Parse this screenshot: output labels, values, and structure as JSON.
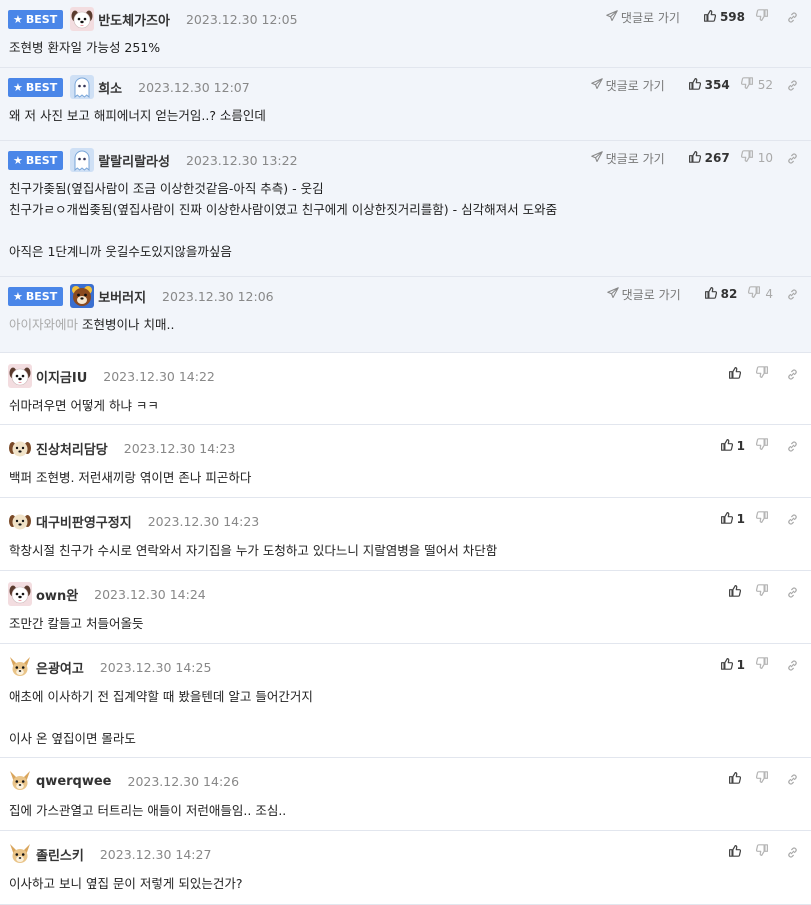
{
  "best_badge_label": "BEST",
  "goto_label": "댓글로 가기",
  "colors": {
    "accent": "#4a86e8",
    "best_bg": "#f2f5fa"
  },
  "comments": [
    {
      "best": true,
      "nick": "반도체가즈아",
      "date": "2023.12.30 12:05",
      "lines": [
        "조현병 환자일 가능성 251%"
      ],
      "muted_prefix": "",
      "up": "598",
      "down": "",
      "avatar_icon": "dog-face-icon"
    },
    {
      "best": true,
      "nick": "희소",
      "date": "2023.12.30 12:07",
      "lines": [
        "왜 저 사진 보고 해피에너지 얻는거임..? 소름인데"
      ],
      "muted_prefix": "",
      "up": "354",
      "down": "52",
      "avatar_icon": "ghost-icon"
    },
    {
      "best": true,
      "nick": "랄랄리랄라성",
      "date": "2023.12.30 13:22",
      "lines": [
        "친구가좆됨(옆집사람이 조금 이상한것같음-아직 추측) - 웃김",
        "친구가ㄹㅇ개씹좆됨(옆집사람이 진짜 이상한사람이였고 친구에게 이상한짓거리를함) - 심각해져서 도와줌",
        "",
        "아직은 1단계니까 웃길수도있지않을까싶음"
      ],
      "muted_prefix": "",
      "up": "267",
      "down": "10",
      "avatar_icon": "ghost-icon"
    },
    {
      "best": true,
      "nick": "보버러지",
      "date": "2023.12.30 12:06",
      "lines": [
        "조현병이나 치매.."
      ],
      "muted_prefix": "아이자와에마",
      "up": "82",
      "down": "4",
      "avatar_icon": "bear-face-icon"
    },
    {
      "best": false,
      "nick": "이지금IU",
      "date": "2023.12.30 14:22",
      "lines": [
        "쉬마려우면 어떻게 하냐 ㅋㅋ"
      ],
      "muted_prefix": "",
      "up": "",
      "down": "",
      "avatar_icon": "dog-face-icon"
    },
    {
      "best": false,
      "nick": "진상처리담당",
      "date": "2023.12.30 14:23",
      "lines": [
        "백퍼 조현병. 저런새끼랑 엮이면 존나 피곤하다"
      ],
      "muted_prefix": "",
      "up": "1",
      "down": "",
      "avatar_icon": "puppy-icon"
    },
    {
      "best": false,
      "nick": "대구비판영구정지",
      "date": "2023.12.30 14:23",
      "lines": [
        "학창시절 친구가 수시로 연락와서 자기집을 누가 도청하고 있다느니 지랄염병을 떨어서 차단함"
      ],
      "muted_prefix": "",
      "up": "1",
      "down": "",
      "avatar_icon": "puppy-icon"
    },
    {
      "best": false,
      "nick": "own완",
      "date": "2023.12.30 14:24",
      "lines": [
        "조만간 칼들고 처들어올듯"
      ],
      "muted_prefix": "",
      "up": "",
      "down": "",
      "avatar_icon": "dog-face-icon"
    },
    {
      "best": false,
      "nick": "은광여고",
      "date": "2023.12.30 14:25",
      "lines": [
        "애초에 이사하기 전 집계약할 때 봤을텐데 알고 들어간거지",
        "",
        "이사 온 옆집이면 몰라도"
      ],
      "muted_prefix": "",
      "up": "1",
      "down": "",
      "avatar_icon": "chihuahua-icon"
    },
    {
      "best": false,
      "nick": "qwerqwee",
      "date": "2023.12.30 14:26",
      "lines": [
        "집에 가스관열고 터트리는 애들이 저런애들임.. 조심.."
      ],
      "muted_prefix": "",
      "up": "",
      "down": "",
      "avatar_icon": "chihuahua-icon"
    },
    {
      "best": false,
      "nick": "졸린스키",
      "date": "2023.12.30 14:27",
      "lines": [
        "이사하고 보니 옆집 문이 저렇게 되있는건가?"
      ],
      "muted_prefix": "",
      "up": "",
      "down": "",
      "avatar_icon": "chihuahua-icon"
    }
  ]
}
